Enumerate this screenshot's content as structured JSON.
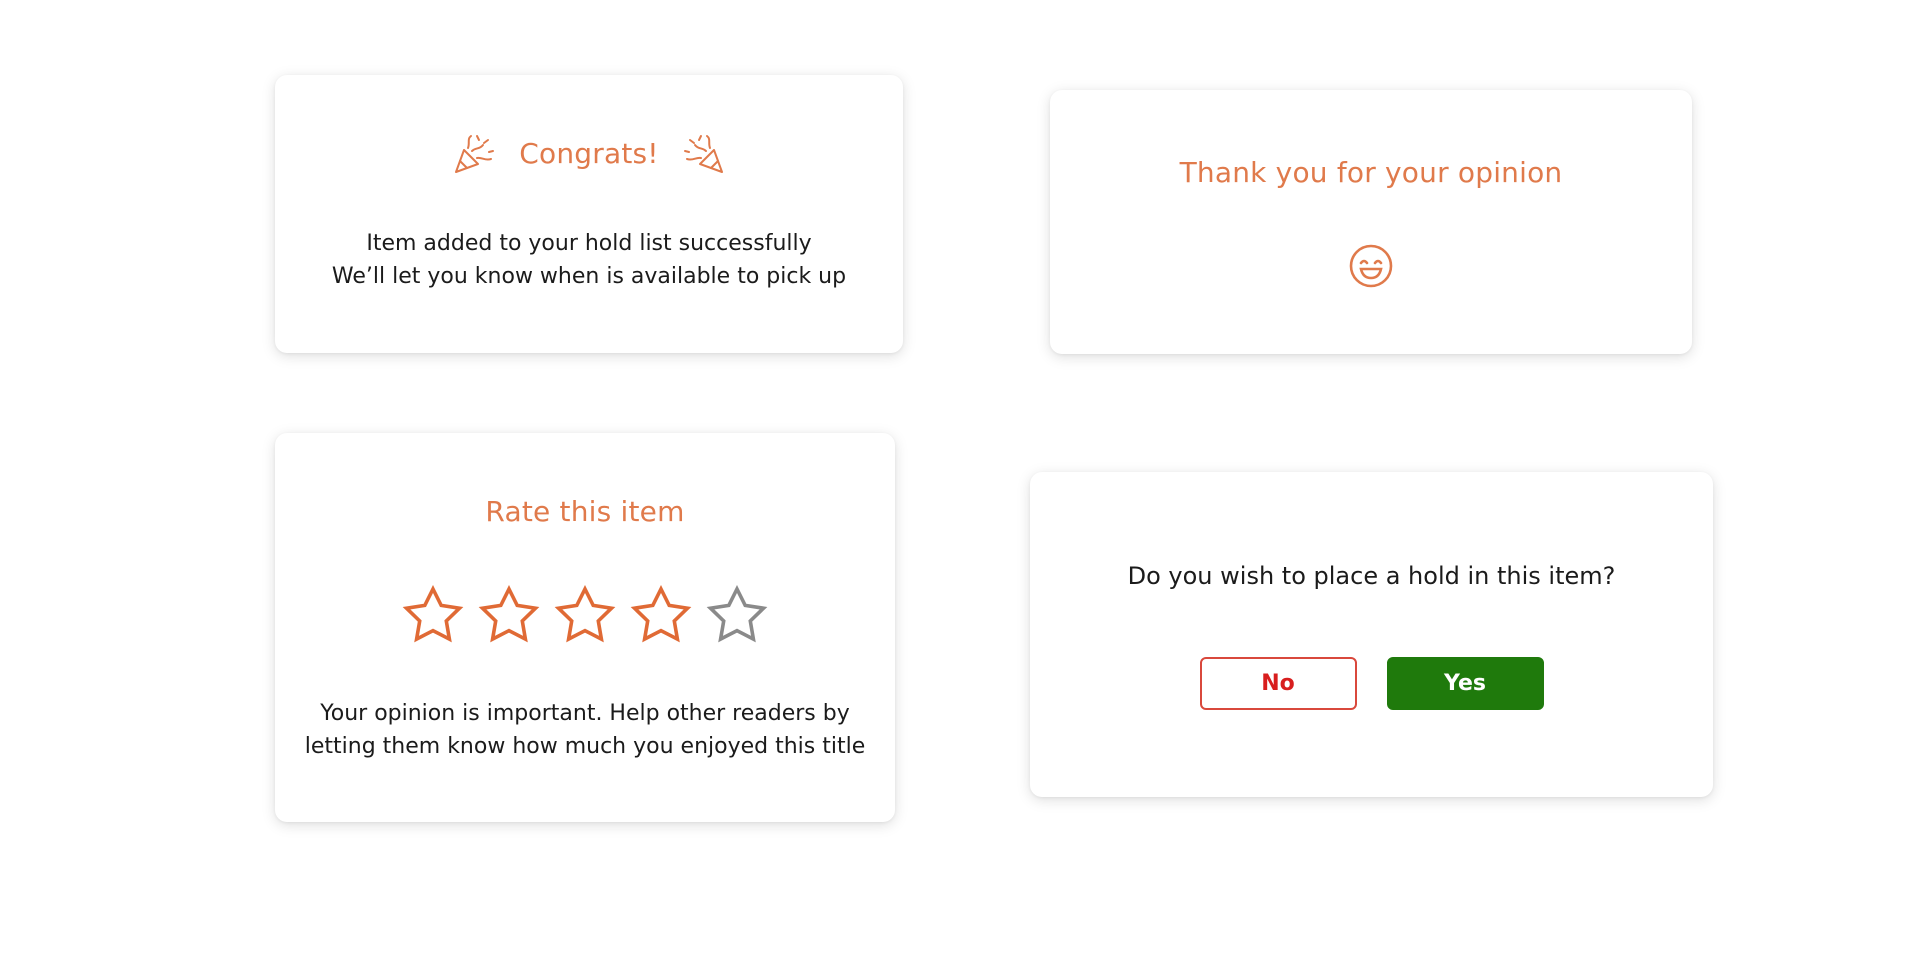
{
  "colors": {
    "accent": "#e07a4b",
    "star_filled": "#e06a35",
    "star_empty": "#8a8a8a",
    "no_button": "#d81e1e",
    "yes_button": "#1f7a0c"
  },
  "congrats_card": {
    "title": "Congrats!",
    "left_icon": "party-popper-icon",
    "right_icon": "party-popper-icon",
    "line1": "Item added to your hold list successfully",
    "line2": "We’ll let you know when is available to pick up"
  },
  "thanks_card": {
    "title": "Thank you for your opinion",
    "icon": "smiley-face-icon"
  },
  "rate_card": {
    "title": "Rate this item",
    "rating": 4,
    "max_rating": 5,
    "line1": "Your opinion is important. Help other readers by",
    "line2": "letting them know how much you enjoyed this title"
  },
  "hold_card": {
    "question": "Do you wish to place a hold in this item?",
    "no_label": "No",
    "yes_label": "Yes"
  }
}
